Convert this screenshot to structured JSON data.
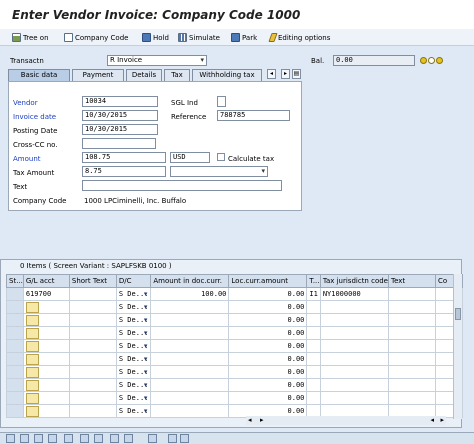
{
  "title": "Enter Vendor Invoice: Company Code 1000",
  "toolbar": {
    "tree_on": "Tree on",
    "company_code": "Company Code",
    "hold": "Hold",
    "simulate": "Simulate",
    "park": "Park",
    "editing_options": "Editing options"
  },
  "header": {
    "transactn_label": "Transactn",
    "transactn_value": "R Invoice",
    "bal_label": "Bal.",
    "bal_value": "0.00"
  },
  "tabs": [
    "Basic data",
    "Payment",
    "Details",
    "Tax",
    "Withholding tax"
  ],
  "form": {
    "vendor_label": "Vendor",
    "vendor_value": "10034",
    "sgl_label": "SGL Ind",
    "invoice_date_label": "Invoice date",
    "invoice_date_value": "10/30/2015",
    "reference_label": "Reference",
    "reference_value": "788785",
    "posting_date_label": "Posting Date",
    "posting_date_value": "10/30/2015",
    "cross_cc_label": "Cross-CC no.",
    "amount_label": "Amount",
    "amount_value": "108.75",
    "currency_value": "USD",
    "calculate_tax_label": "Calculate tax",
    "tax_amount_label": "Tax Amount",
    "tax_amount_value": "8.75",
    "text_label": "Text",
    "company_code_label": "Company Code",
    "company_code_value": "1000 LPCiminelli, Inc. Buffalo"
  },
  "grid": {
    "title": "0 Items ( Screen Variant : SAPLFSKB 0100 )",
    "columns": [
      "St...",
      "G/L acct",
      "Short Text",
      "D/C",
      "Amount in doc.curr.",
      "Loc.curr.amount",
      "T...",
      "Tax jurisdictn code",
      "Text",
      "Co"
    ],
    "rows": [
      {
        "gl": "619700",
        "dc": "S De...",
        "amount": "100.00",
        "loc": "0.00",
        "t": "I1",
        "jur": "NY1000000"
      },
      {
        "gl": "",
        "dc": "S De...",
        "amount": "",
        "loc": "0.00",
        "t": "",
        "jur": ""
      },
      {
        "gl": "",
        "dc": "S De...",
        "amount": "",
        "loc": "0.00",
        "t": "",
        "jur": ""
      },
      {
        "gl": "",
        "dc": "S De...",
        "amount": "",
        "loc": "0.00",
        "t": "",
        "jur": ""
      },
      {
        "gl": "",
        "dc": "S De...",
        "amount": "",
        "loc": "0.00",
        "t": "",
        "jur": ""
      },
      {
        "gl": "",
        "dc": "S De...",
        "amount": "",
        "loc": "0.00",
        "t": "",
        "jur": ""
      },
      {
        "gl": "",
        "dc": "S De...",
        "amount": "",
        "loc": "0.00",
        "t": "",
        "jur": ""
      },
      {
        "gl": "",
        "dc": "S De...",
        "amount": "",
        "loc": "0.00",
        "t": "",
        "jur": ""
      },
      {
        "gl": "",
        "dc": "S De...",
        "amount": "",
        "loc": "0.00",
        "t": "",
        "jur": ""
      },
      {
        "gl": "",
        "dc": "S De...",
        "amount": "",
        "loc": "0.00",
        "t": "",
        "jur": ""
      }
    ]
  },
  "colors": {
    "accent_blue": "#1a3fc0",
    "light_blue": "#dfe9f5",
    "status_green": "#3a9a3a"
  }
}
